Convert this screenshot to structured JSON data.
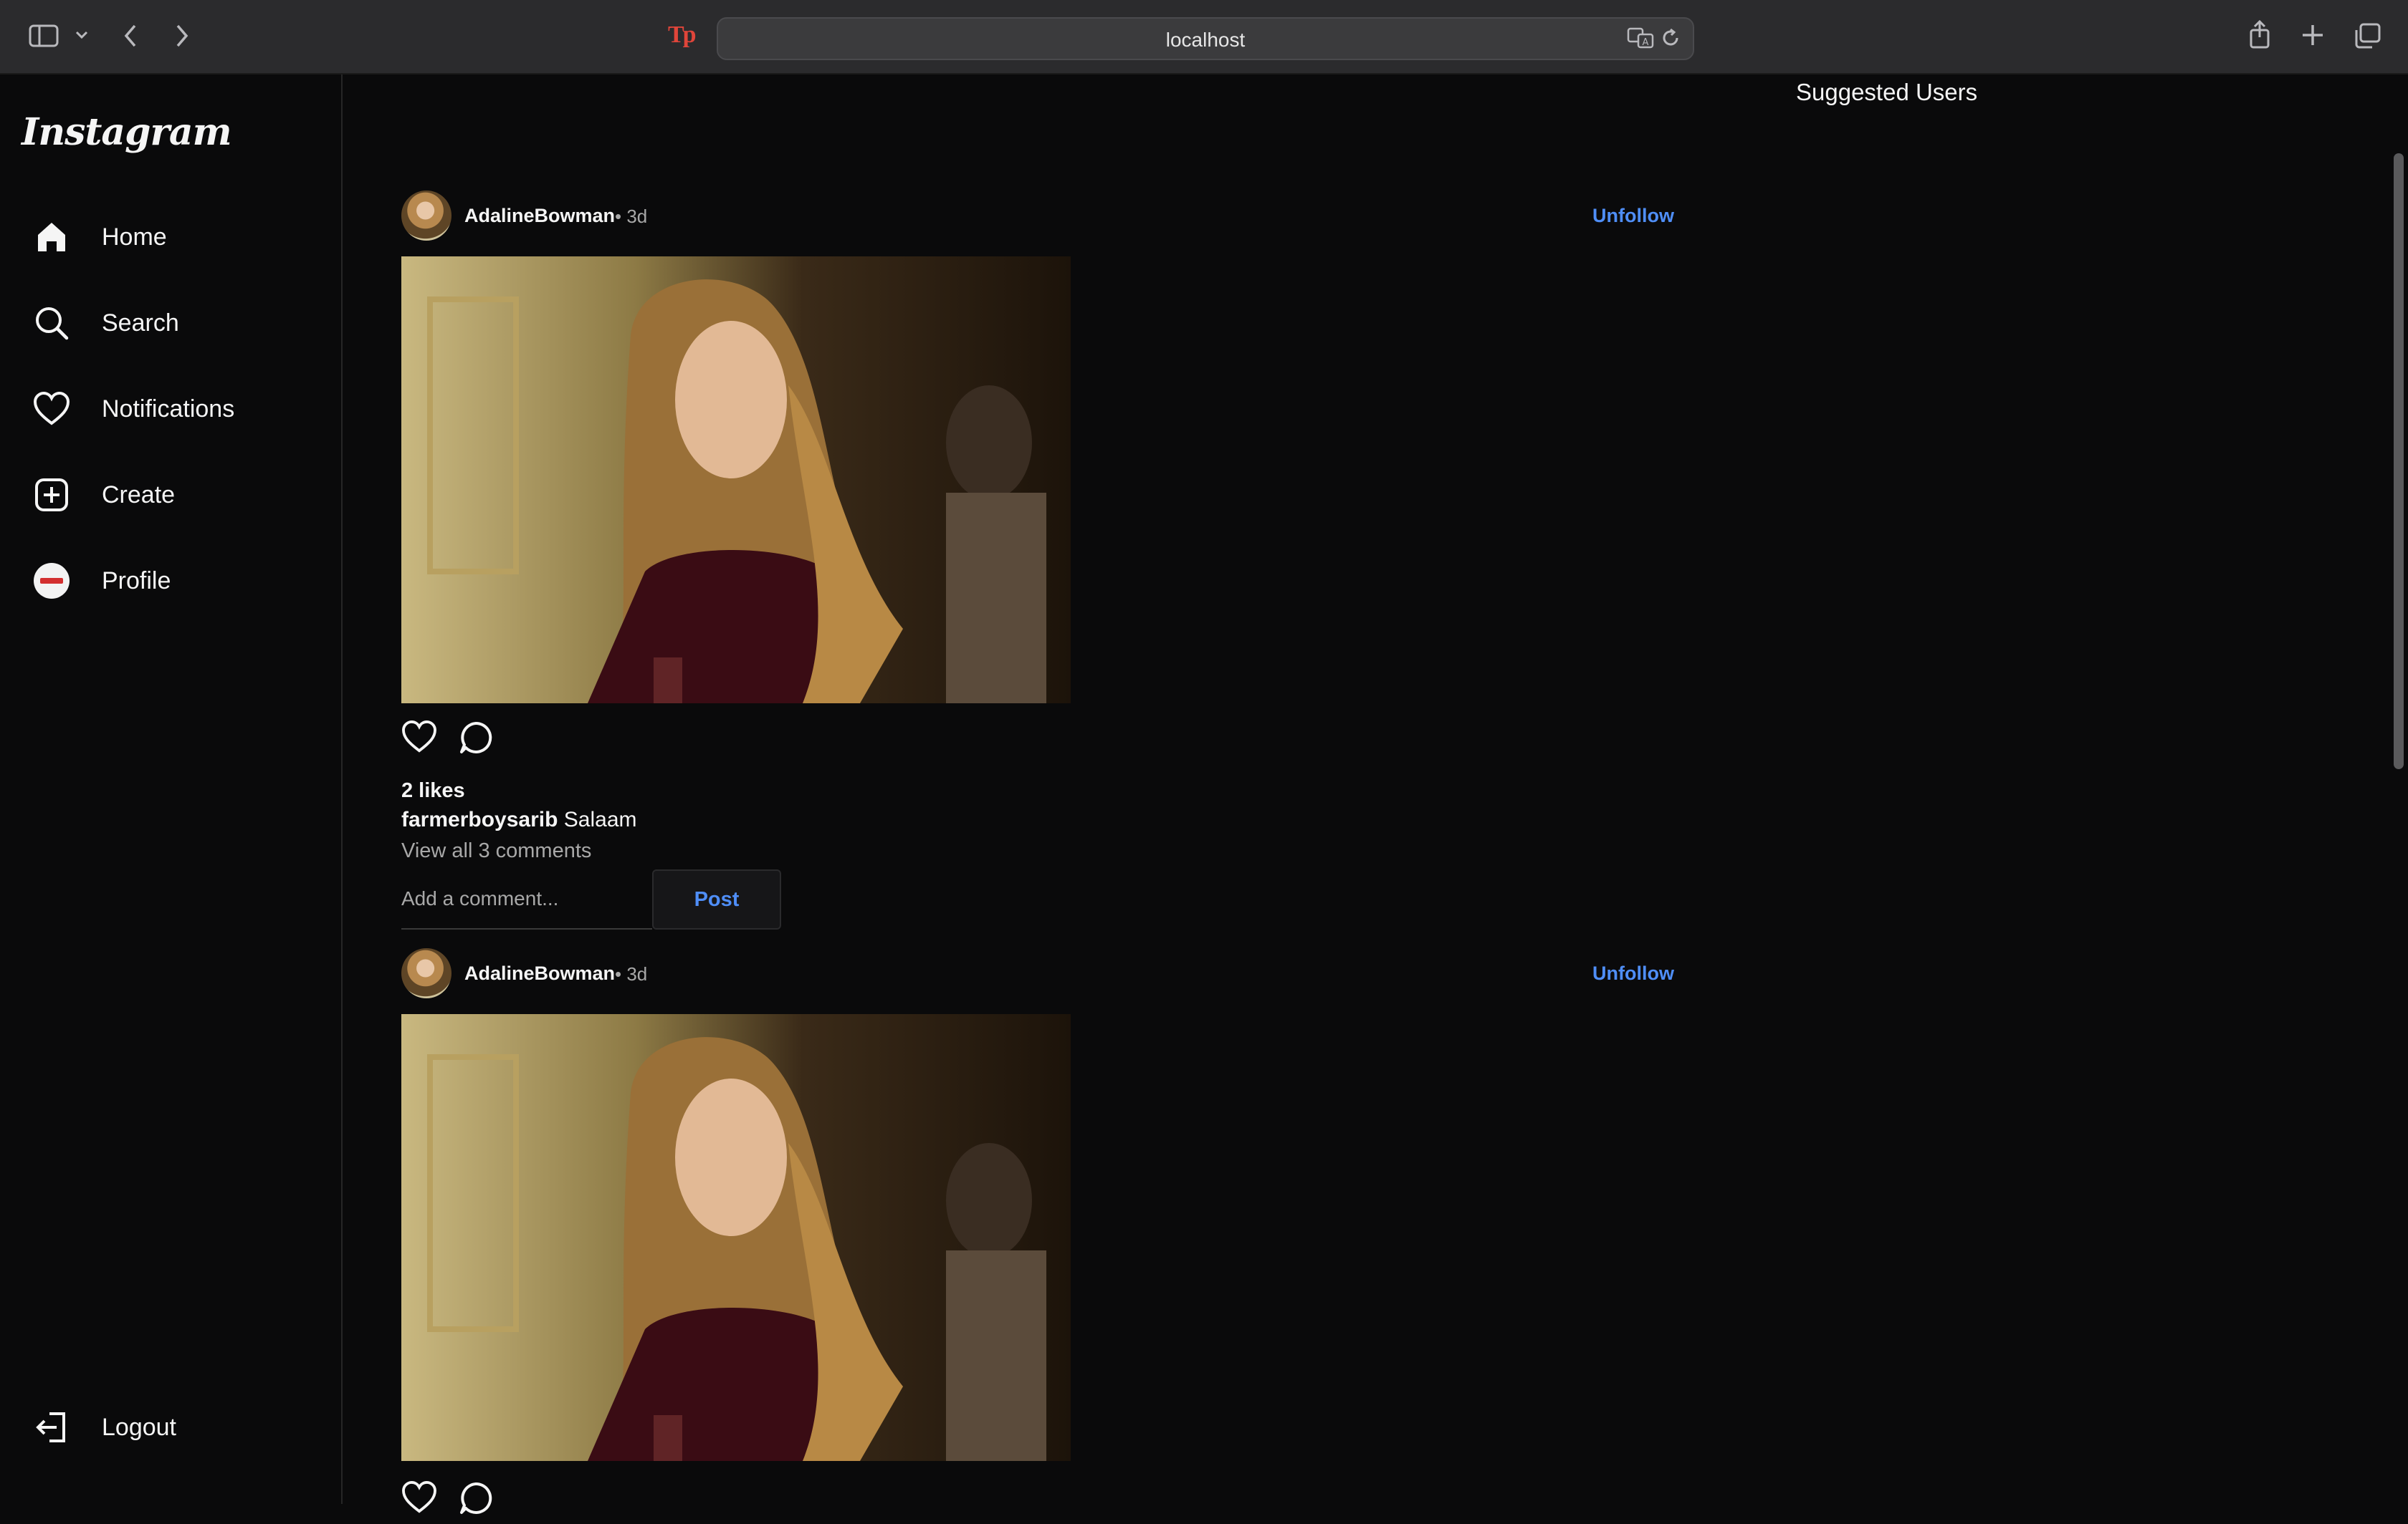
{
  "browser": {
    "url": "localhost",
    "extension_logo_text": "Tp"
  },
  "sidebar": {
    "brand": "Instagram",
    "items": [
      {
        "label": "Home",
        "icon": "home-icon"
      },
      {
        "label": "Search",
        "icon": "search-icon"
      },
      {
        "label": "Notifications",
        "icon": "heart-icon"
      },
      {
        "label": "Create",
        "icon": "plus-square-icon"
      },
      {
        "label": "Profile",
        "icon": "avatar"
      }
    ],
    "logout_label": "Logout"
  },
  "suggested_users_title": "Suggested Users",
  "posts": [
    {
      "username": "AdalineBowman",
      "time": "• 3d",
      "unfollow_label": "Unfollow",
      "likes": "2 likes",
      "caption_user": "farmerboysarib",
      "caption_text": "Salaam",
      "view_comments": "View all 3 comments",
      "comment_placeholder": "Add a comment...",
      "post_button": "Post"
    },
    {
      "username": "AdalineBowman",
      "time": "• 3d",
      "unfollow_label": "Unfollow"
    }
  ],
  "colors": {
    "background": "#0a0a0b",
    "accent": "#4f8ef7",
    "chrome": "#2b2b2d",
    "muted_text": "#a8a8a8"
  }
}
